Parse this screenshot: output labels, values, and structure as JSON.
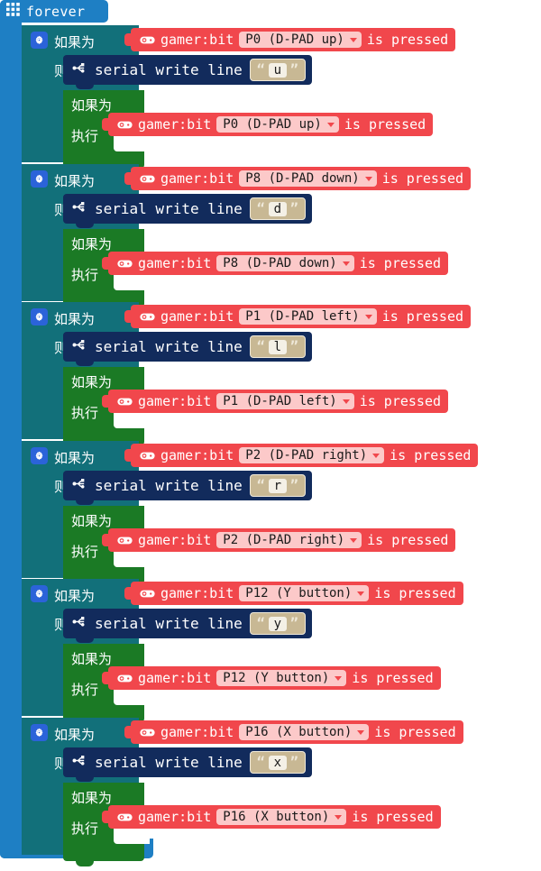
{
  "forever": {
    "label": "forever",
    "icon": "grid-icon",
    "color": "#1e7fc4"
  },
  "colors": {
    "forever": "#1e7fc4",
    "if_outer": "#12707a",
    "if_inner": "#1b7a25",
    "serial": "#122b5c",
    "boolean": "#f1474c",
    "dropdown": "#fcc9c9",
    "string_field": "#c8b894",
    "gear_badge": "#2b63d9"
  },
  "labels": {
    "if": "如果为",
    "then": "则",
    "do": "执行",
    "gamer_bit": "gamer:bit",
    "is_pressed": "is pressed",
    "serial_write_line": "serial write line",
    "gear_icon": "gear-icon",
    "gamepad_icon": "gamepad-icon",
    "usb_icon": "usb-icon",
    "quote_open": "“",
    "quote_close": "”"
  },
  "groups": [
    {
      "pin": "P0 (D-PAD up)",
      "char": "u",
      "outer_width": 414,
      "inner_width": 430
    },
    {
      "pin": "P8 (D-PAD down)",
      "char": "d",
      "outer_width": 434,
      "inner_width": 452
    },
    {
      "pin": "P1 (D-PAD left)",
      "char": "l",
      "outer_width": 428,
      "inner_width": 446
    },
    {
      "pin": "P2 (D-PAD right)",
      "char": "r",
      "outer_width": 438,
      "inner_width": 456
    },
    {
      "pin": "P12 (Y button)",
      "char": "y",
      "outer_width": 410,
      "inner_width": 428
    },
    {
      "pin": "P16 (X button)",
      "char": "x",
      "outer_width": 414,
      "inner_width": 432
    }
  ]
}
